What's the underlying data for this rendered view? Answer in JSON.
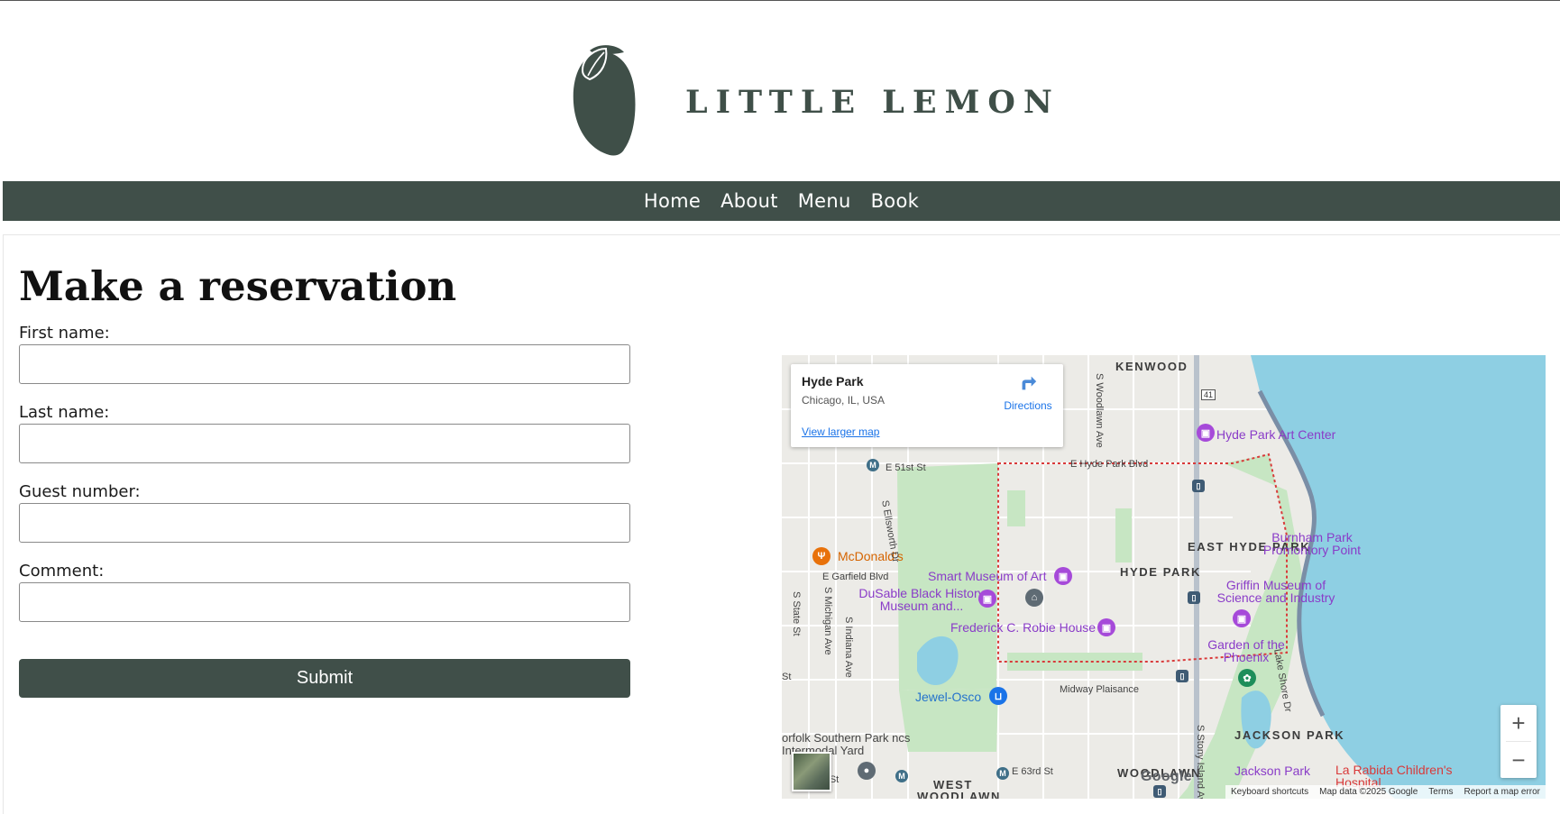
{
  "brand": {
    "name": "LITTLE LEMON"
  },
  "nav": {
    "items": [
      "Home",
      "About",
      "Menu",
      "Book"
    ]
  },
  "form": {
    "title": "Make a reservation",
    "fields": [
      {
        "label": "First name:",
        "value": ""
      },
      {
        "label": "Last name:",
        "value": ""
      },
      {
        "label": "Guest number:",
        "value": ""
      },
      {
        "label": "Comment:",
        "value": ""
      }
    ],
    "submit_label": "Submit"
  },
  "map": {
    "info": {
      "title": "Hyde Park",
      "address": "Chicago, IL, USA",
      "directions": "Directions",
      "larger_map": "View larger map"
    },
    "labels": {
      "kenwood": "KENWOOD",
      "hyde_park_art_center": "Hyde Park Art Center",
      "e_hyde_park_blvd": "E Hyde Park Blvd",
      "e_51st": "E 51st St",
      "s_ellsworth": "S Ellsworth Dr",
      "s_woodlawn": "S Woodlawn Ave",
      "east_hyde_park": "EAST HYDE PARK",
      "burnham_park": "Burnham Park Promontory Point",
      "mcdonalds": "McDonald's",
      "smart_museum": "Smart Museum of Art",
      "hyde_park_area": "HYDE PARK",
      "e_garfield": "E Garfield Blvd",
      "dusable": "DuSable Black History Museum and...",
      "griffin": "Griffin Museum of Science and Industry",
      "robie": "Frederick C. Robie House",
      "s_state": "S State St",
      "s_michigan": "S Michigan Ave",
      "s_indiana": "S Indiana Ave",
      "garden_phoenix": "Garden of the Phoenix",
      "lake_shore": "Lake Shore Dr",
      "midway": "Midway Plaisance",
      "jewel": "Jewel-Osco",
      "jackson_park_area": "JACKSON PARK",
      "norfolk": "orfolk Southern Park ncs Intermodal Yard",
      "s_stony": "S Stony Island Ave",
      "west_woodlawn": "WEST WOODLAWN",
      "e_63rd": "E 63rd St",
      "woodlawn": "WOODLAWN",
      "jackson_park": "Jackson Park",
      "la_rabida": "La Rabida Children's Hospital",
      "st_left": "St",
      "rd_st": "rd St",
      "route_41": "41"
    },
    "zoom_in": "+",
    "zoom_out": "−",
    "attribution": {
      "shortcuts": "Keyboard shortcuts",
      "data": "Map data ©2025 Google",
      "terms": "Terms",
      "report": "Report a map error"
    },
    "logo": "Google",
    "icons": [
      "directions-icon",
      "zoom-in-icon",
      "zoom-out-icon",
      "museum-icon",
      "restaurant-icon",
      "shopping-icon",
      "transit-icon",
      "school-icon"
    ]
  },
  "colors": {
    "brand_green": "#404f49",
    "logo_green": "#3f4f48",
    "water": "#8ecfe3",
    "park": "#c7e6c3",
    "route_border": "#d93a3a"
  }
}
